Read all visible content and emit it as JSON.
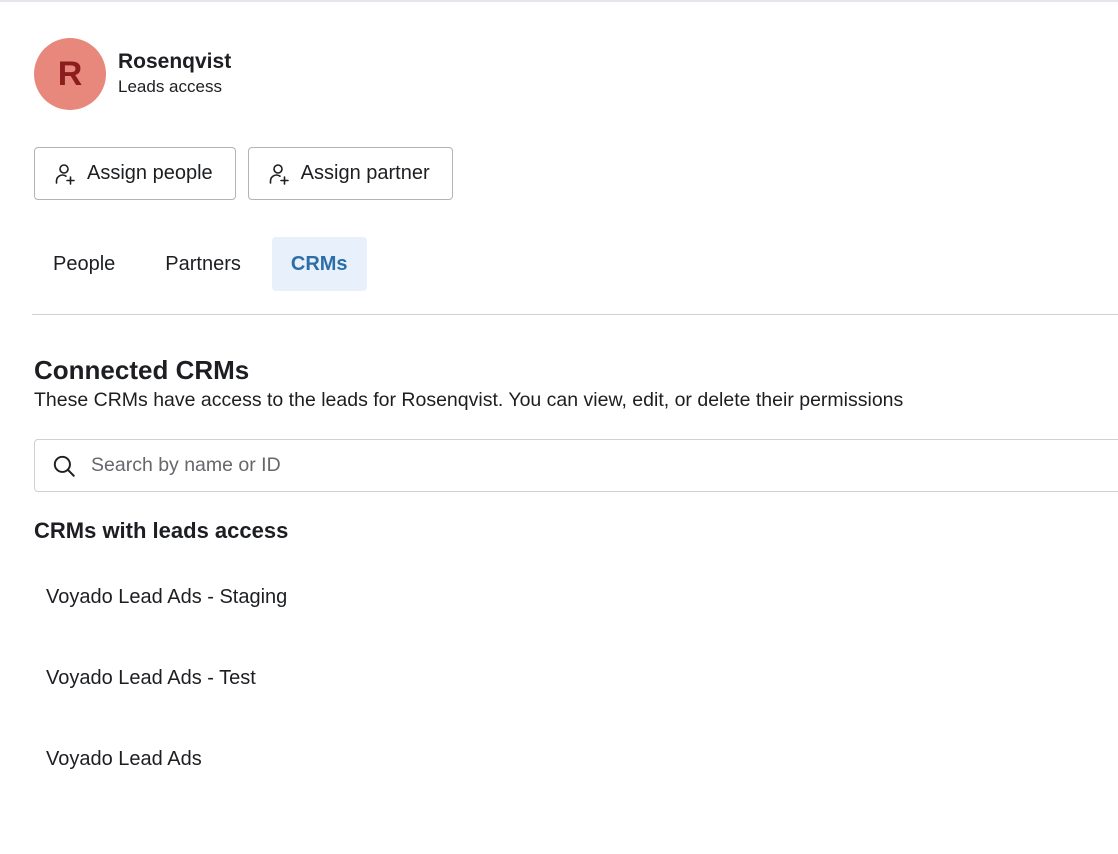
{
  "account": {
    "initial": "R",
    "name": "Rosenqvist",
    "subtitle": "Leads access"
  },
  "actions": {
    "assign_people": "Assign people",
    "assign_partner": "Assign partner"
  },
  "tabs": [
    {
      "label": "People",
      "active": false
    },
    {
      "label": "Partners",
      "active": false
    },
    {
      "label": "CRMs",
      "active": true
    }
  ],
  "section": {
    "title": "Connected CRMs",
    "description": "These CRMs have access to the leads for Rosenqvist. You can view, edit, or delete their permissions"
  },
  "search": {
    "placeholder": "Search by name or ID",
    "value": ""
  },
  "list": {
    "title": "CRMs with leads access",
    "items": [
      "Voyado Lead Ads - Staging",
      "Voyado Lead Ads - Test",
      "Voyado Lead Ads"
    ]
  },
  "colors": {
    "avatar_bg": "#e8877c",
    "avatar_text": "#8b1d1d",
    "active_tab_bg": "#e7f0fb",
    "active_tab_text": "#2d6ea8"
  }
}
